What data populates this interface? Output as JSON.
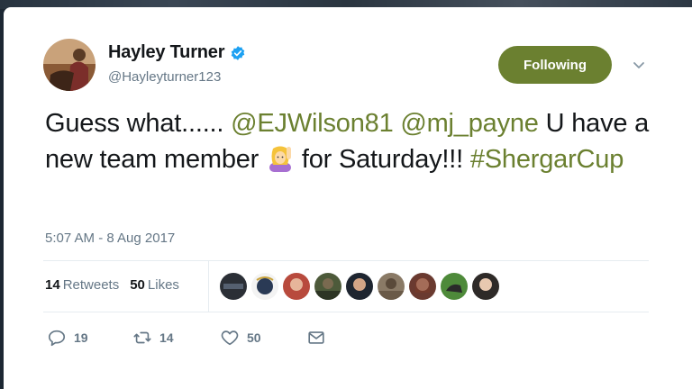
{
  "tweet": {
    "author": {
      "name": "Hayley Turner",
      "handle": "@Hayleyturner123",
      "verified": true
    },
    "follow_button_label": "Following",
    "text": {
      "part1": "Guess what...... ",
      "mention1": "@EJWilson81",
      "mention2": "@mj_payne",
      "part2": " U have a new team member ",
      "emoji": "person-raising-hand",
      "part3": " for Saturday!!! ",
      "hashtag": "#ShergarCup"
    },
    "timestamp": "5:07 AM - 8 Aug 2017",
    "stats": {
      "retweets_count": "14",
      "retweets_label": "Retweets",
      "likes_count": "50",
      "likes_label": "Likes"
    },
    "liker_avatar_count": 9,
    "actions": {
      "reply_count": "19",
      "retweet_count": "14",
      "like_count": "50"
    }
  },
  "colors": {
    "accent": "#6b8030",
    "text_primary": "#14171a",
    "text_secondary": "#657786",
    "verified": "#1da1f2"
  }
}
